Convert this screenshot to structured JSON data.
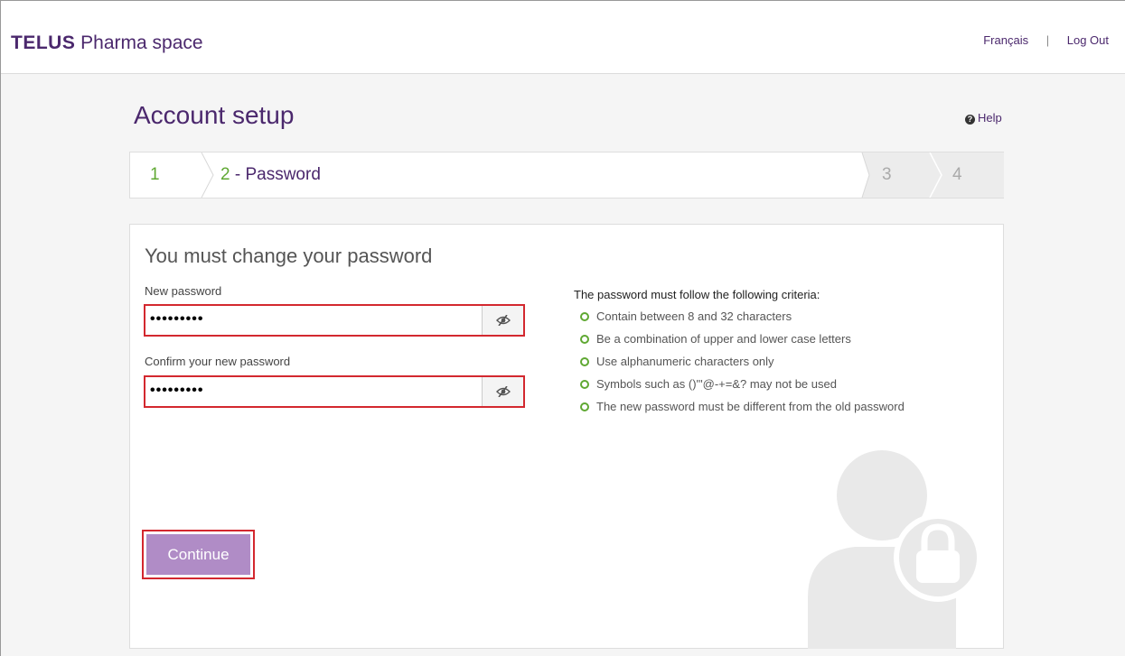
{
  "header": {
    "brand_bold": "TELUS",
    "brand_rest": " Pharma space",
    "lang_link": "Français",
    "separator": "|",
    "logout_link": "Log Out"
  },
  "page": {
    "title": "Account setup",
    "help_label": "Help",
    "help_icon": "question-circle-icon"
  },
  "stepper": {
    "steps": [
      {
        "number": "1",
        "label": ""
      },
      {
        "number": "2",
        "label": " - Password"
      },
      {
        "number": "3",
        "label": ""
      },
      {
        "number": "4",
        "label": ""
      }
    ],
    "active_step": 2
  },
  "form": {
    "title": "You must change your password",
    "new_password": {
      "label": "New password",
      "value": "•••••••••"
    },
    "confirm_password": {
      "label": "Confirm your new password",
      "value": "•••••••••"
    },
    "toggle_icon": "eye-slash-icon",
    "continue_label": "Continue"
  },
  "criteria": {
    "title": "The password must follow the following criteria:",
    "items": [
      "Contain between 8 and 32 characters",
      "Be a combination of upper and lower case letters",
      "Use alphanumeric characters only",
      "Symbols such as ()'\"@-+=&? may not be used",
      "The new password must be different from the old password"
    ]
  },
  "colors": {
    "brand_purple": "#4b286d",
    "accent_green": "#5fa832",
    "button_purple": "#b08cc6",
    "highlight_red": "#d3282f"
  }
}
